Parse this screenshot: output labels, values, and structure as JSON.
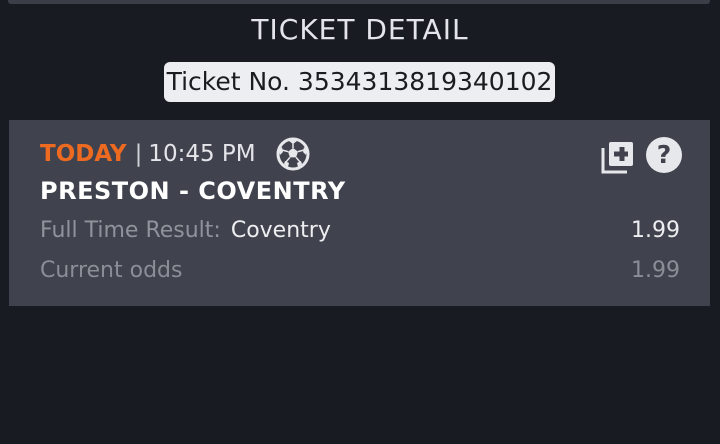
{
  "header": {
    "title": "TICKET DETAIL",
    "ticket_number": "Ticket No. 3534313819340102"
  },
  "bet": {
    "day_label": "TODAY",
    "separator": "|",
    "time": "10:45 PM",
    "sport_icon": "soccer-ball-icon",
    "match": "PRESTON - COVENTRY",
    "market_label": "Full Time Result:",
    "selection": "Coventry",
    "odds": "1.99",
    "current_odds_label": "Current odds",
    "current_odds": "1.99",
    "actions": {
      "add_icon": "add-to-betslip-icon",
      "help_icon": "help-icon",
      "help_glyph": "?"
    }
  },
  "colors": {
    "background": "#181b22",
    "card": "#40434d",
    "accent": "#ee6a20",
    "ticket_pill": "#eceef1"
  }
}
